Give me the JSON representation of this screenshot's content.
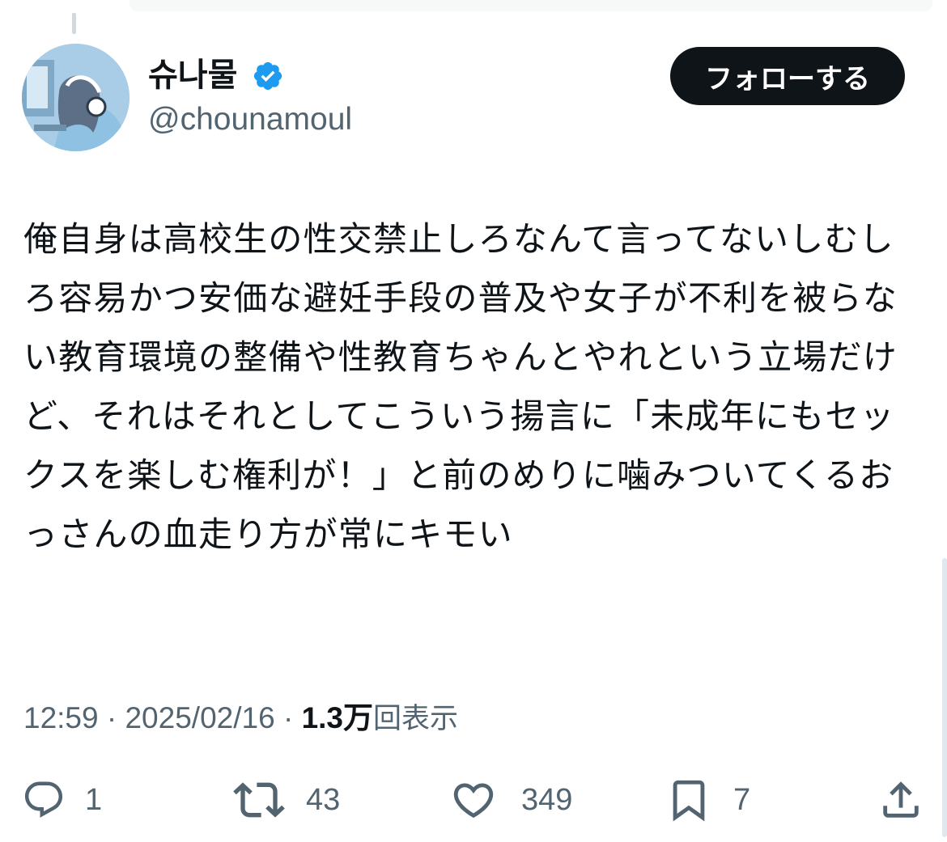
{
  "tweet": {
    "author": {
      "display_name": "슈나물",
      "handle": "@chounamoul",
      "verified_icon": "verified-badge-icon"
    },
    "follow_label": "フォローする",
    "text": "俺自身は高校生の性交禁止しろなんて言ってないしむしろ容易かつ安価な避妊手段の普及や女子が不利を被らない教育環境の整備や性教育ちゃんとやれという立場だけど、それはそれとしてこういう揚言に「未成年にもセックスを楽しむ権利が！」と前のめりに噛みついてくるおっさんの血走り方が常にキモい",
    "time": "12:59",
    "date": "2025/02/16",
    "views_count": "1.3万",
    "views_label": "回表示",
    "actions": {
      "replies": "1",
      "retweets": "43",
      "likes": "349",
      "bookmarks": "7"
    }
  },
  "colors": {
    "text_primary": "#0f1419",
    "text_secondary": "#536471",
    "verified_blue": "#1d9bf0",
    "button_bg": "#0f1419"
  }
}
